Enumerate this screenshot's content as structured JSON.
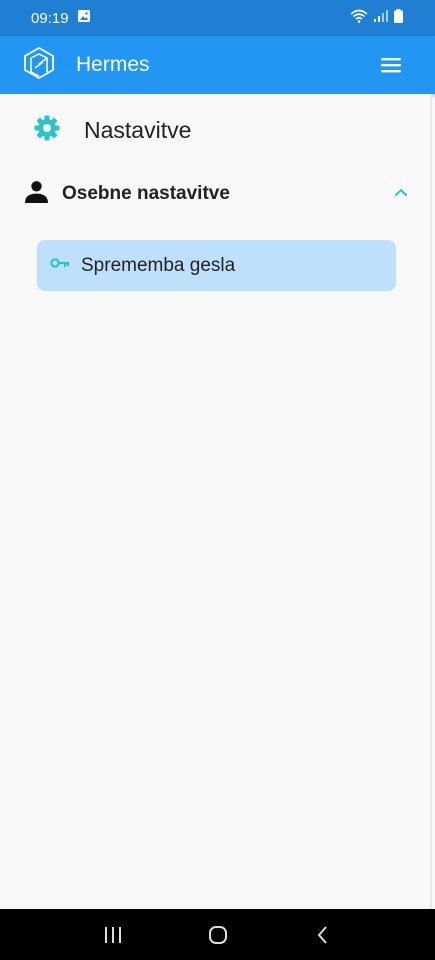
{
  "status_bar": {
    "time": "09:19"
  },
  "app_bar": {
    "title": "Hermes"
  },
  "page": {
    "title": "Nastavitve"
  },
  "section": {
    "title": "Osebne nastavitve",
    "expanded": true,
    "items": [
      {
        "label": "Sprememba gesla",
        "icon": "key-icon",
        "selected": true
      }
    ]
  },
  "colors": {
    "status_bar": "#1f7fd3",
    "app_bar": "#2196f3",
    "accent_teal": "#2ec4c4",
    "selected_item": "#bfe0fa"
  }
}
